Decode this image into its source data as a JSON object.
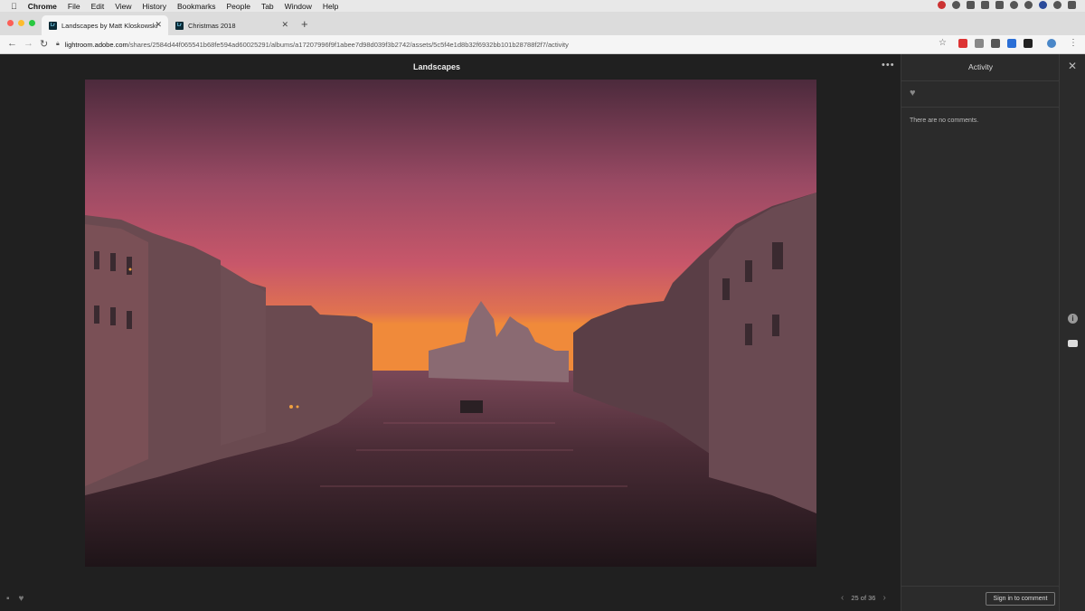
{
  "menubar": {
    "app": "Chrome",
    "items": [
      "File",
      "Edit",
      "View",
      "History",
      "Bookmarks",
      "People",
      "Tab",
      "Window",
      "Help"
    ]
  },
  "tabs": [
    {
      "label": "Landscapes by Matt Kloskowski",
      "favicon": "Lr"
    },
    {
      "label": "Christmas 2018",
      "favicon": "Lr"
    }
  ],
  "address": {
    "host": "lightroom.adobe.com",
    "path": "/shares/2584d44f065541b68fe594ad60025291/albums/a17207996f9f1abee7d98d039f3b2742/assets/5c5f4e1d8b32f6932bb101b28788f2f7/activity"
  },
  "viewer": {
    "album_title": "Landscapes",
    "pager": "25 of 36"
  },
  "activity": {
    "title": "Activity",
    "empty_text": "There are no comments.",
    "sign_in_label": "Sign in to comment"
  },
  "icons": {
    "close": "close-icon",
    "info": "info-icon",
    "comment": "comment-icon",
    "heart": "heart-icon"
  }
}
